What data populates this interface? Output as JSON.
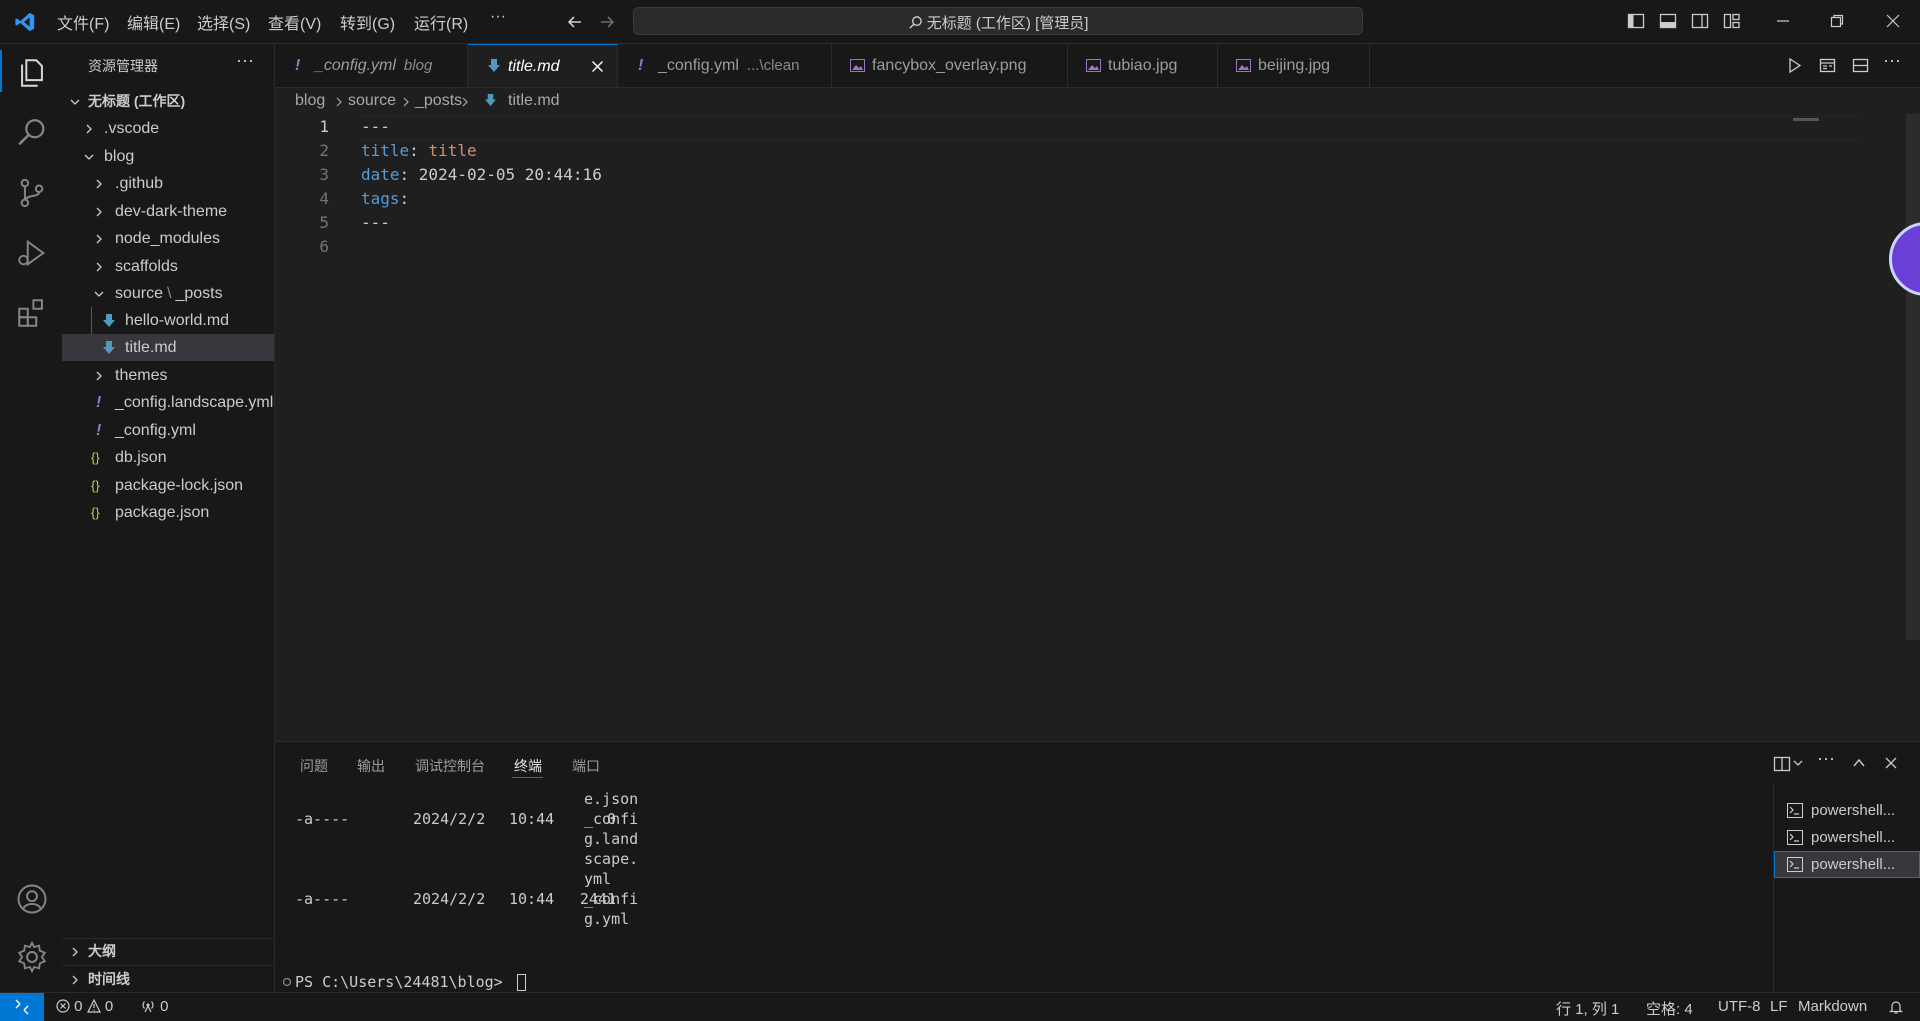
{
  "menu": [
    "文件(F)",
    "编辑(E)",
    "选择(S)",
    "查看(V)",
    "转到(G)",
    "运行(R)",
    "···"
  ],
  "window_title": "无标题 (工作区) [管理员]",
  "sidebar": {
    "title": "资源管理器",
    "workspace": "无标题 (工作区)",
    "items": [
      {
        "label": ".vscode"
      },
      {
        "label": "blog"
      },
      {
        "label": ".github"
      },
      {
        "label": "dev-dark-theme"
      },
      {
        "label": "node_modules"
      },
      {
        "label": "scaffolds"
      },
      {
        "label": "source",
        "label2": "_posts"
      },
      {
        "label": "hello-world.md"
      },
      {
        "label": "title.md"
      },
      {
        "label": "themes"
      },
      {
        "label": "_config.landscape.yml"
      },
      {
        "label": "_config.yml"
      },
      {
        "label": "db.json"
      },
      {
        "label": "package-lock.json"
      },
      {
        "label": "package.json"
      }
    ],
    "outline": "大纲",
    "timeline": "时间线"
  },
  "tabs": [
    {
      "label": "_config.yml",
      "desc": "blog"
    },
    {
      "label": "title.md",
      "desc": ""
    },
    {
      "label": "_config.yml",
      "desc": "...\\clean"
    },
    {
      "label": "fancybox_overlay.png",
      "desc": ""
    },
    {
      "label": "tubiao.jpg",
      "desc": ""
    },
    {
      "label": "beijing.jpg",
      "desc": ""
    }
  ],
  "breadcrumb": [
    "blog",
    "source",
    "_posts",
    "title.md"
  ],
  "editor": {
    "line_numbers": [
      "1",
      "2",
      "3",
      "4",
      "5",
      "6"
    ],
    "lines": [
      {
        "key": "---",
        "val": ""
      },
      {
        "key": "title",
        "sep": ": ",
        "val": "title"
      },
      {
        "key": "date",
        "sep": ": ",
        "val": "2024-02-05 20:44:16"
      },
      {
        "key": "tags",
        "sep": ":",
        "val": ""
      },
      {
        "key": "---",
        "val": ""
      },
      {
        "key": "",
        "val": ""
      }
    ]
  },
  "panel": {
    "tabs": [
      "问题",
      "输出",
      "调试控制台",
      "终端",
      "端口"
    ],
    "terminal": {
      "row1": {
        "mode": "-a----",
        "date": "2024/2/2",
        "time": "10:44",
        "size": "0",
        "name": [
          "e.json",
          "_confi",
          "g.land",
          "scape.",
          "yml"
        ]
      },
      "row2": {
        "mode": "-a----",
        "date": "2024/2/2",
        "time": "10:44",
        "size": "2441",
        "name": [
          "_confi",
          "g.yml"
        ]
      },
      "prompt": "PS C:\\Users\\24481\\blog> "
    },
    "terminals": [
      "powershell...",
      "powershell...",
      "powershell..."
    ]
  },
  "status": {
    "errors": "0",
    "warnings": "0",
    "ports": "0",
    "position": "行 1, 列 1",
    "spaces": "空格: 4",
    "encoding": "UTF-8",
    "eol": "LF",
    "language": "Markdown"
  },
  "colors": {
    "accent": "#0078d4",
    "yaml_key": "#569cd6",
    "yaml_value": "#ce9178",
    "md_icon": "#519aba",
    "yml_icon": "#a074c4",
    "json_icon": "#cbcb41"
  }
}
